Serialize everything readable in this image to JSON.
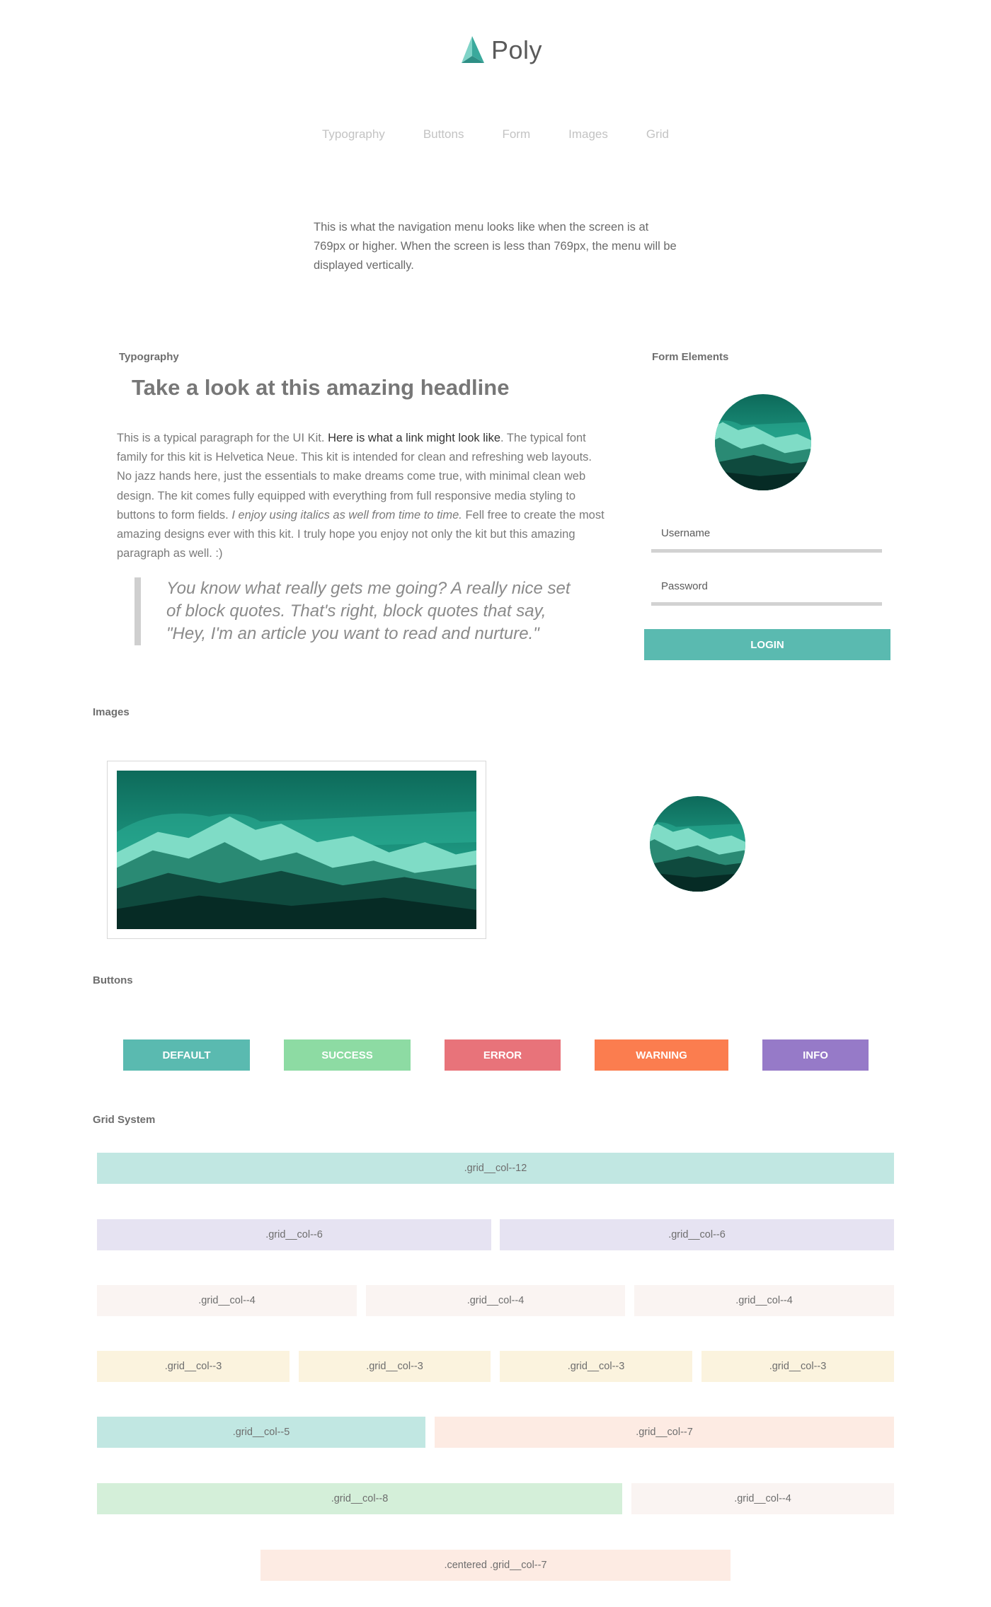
{
  "header": {
    "logo_text": "Poly"
  },
  "nav": {
    "items": [
      "Typography",
      "Buttons",
      "Form",
      "Images",
      "Grid"
    ]
  },
  "intro": {
    "text": "This is what the navigation menu looks like when the screen is at 769px or higher. When the screen is less than 769px, the menu will be displayed vertically."
  },
  "typography": {
    "section_title": "Typography",
    "headline": "Take a look at this amazing headline",
    "para_1": "This is a typical paragraph for the UI Kit. ",
    "link": "Here is what a link might look like",
    "para_2": ". The typical font family for this kit is Helvetica Neue. This kit is intended for clean and refreshing web layouts. No jazz hands here, just the essentials to make dreams come true, with minimal clean web design. The kit comes fully equipped with everything from full responsive media styling to buttons to form fields. ",
    "italic": "I enjoy using italics as well from time to time.",
    "para_3": " Fell free to create the most amazing designs ever with this kit. I truly hope you enjoy not only the kit but this amazing paragraph as well. :)",
    "quote": "You know what really gets me going? A really nice set of block quotes. That's right, block quotes that say, \"Hey, I'm an article you want to read and nurture.\""
  },
  "form": {
    "section_title": "Form Elements",
    "username_label": "Username",
    "password_label": "Password",
    "login_label": "LOGIN"
  },
  "images": {
    "section_title": "Images"
  },
  "buttons": {
    "section_title": "Buttons",
    "items": [
      {
        "label": "DEFAULT",
        "color": "#5abab0"
      },
      {
        "label": "SUCCESS",
        "color": "#8ddba3"
      },
      {
        "label": "ERROR",
        "color": "#e8737a"
      },
      {
        "label": "WARNING",
        "color": "#fb7d4f"
      },
      {
        "label": "INFO",
        "color": "#967ac8"
      }
    ]
  },
  "grid": {
    "section_title": "Grid System",
    "rows": [
      [
        {
          "label": ".grid__col--12",
          "color": "#c1e7e2"
        }
      ],
      [
        {
          "label": ".grid__col--6",
          "color": "#e6e3f2"
        },
        {
          "label": ".grid__col--6",
          "color": "#e6e3f2"
        }
      ],
      [
        {
          "label": ".grid__col--4",
          "color": "#faf4f2"
        },
        {
          "label": ".grid__col--4",
          "color": "#faf4f2"
        },
        {
          "label": ".grid__col--4",
          "color": "#faf4f2"
        }
      ],
      [
        {
          "label": ".grid__col--3",
          "color": "#fbf3de"
        },
        {
          "label": ".grid__col--3",
          "color": "#fbf3de"
        },
        {
          "label": ".grid__col--3",
          "color": "#fbf3de"
        },
        {
          "label": ".grid__col--3",
          "color": "#fbf3de"
        }
      ],
      [
        {
          "label": ".grid__col--5",
          "color": "#c1e7e2"
        },
        {
          "label": ".grid__col--7",
          "color": "#fdebe3"
        }
      ],
      [
        {
          "label": ".grid__col--8",
          "color": "#d4efd9"
        },
        {
          "label": ".grid__col--4",
          "color": "#faf4f2"
        }
      ],
      [
        {
          "label": ".centered .grid__col--7",
          "color": "#fdebe3"
        }
      ]
    ]
  }
}
